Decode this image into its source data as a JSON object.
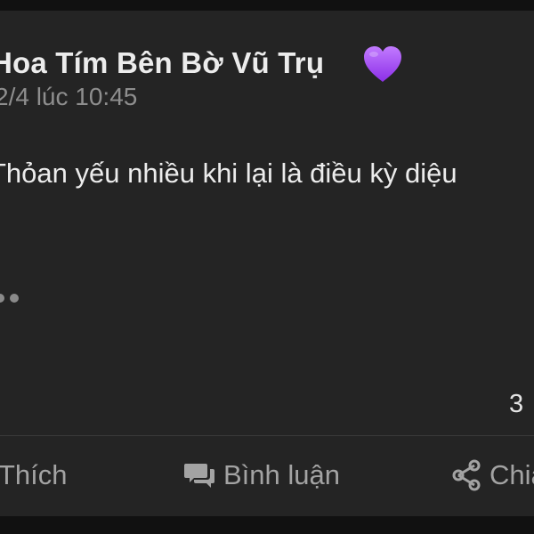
{
  "post": {
    "author": "Hoa Tím Bên Bờ Vũ Trụ",
    "author_emoji": "purple-heart",
    "timestamp": "2/4 lúc 10:45",
    "text": "Thỏan yếu nhiều khi lại là điều kỳ diệu",
    "more_indicator": "...",
    "reaction_count": "3"
  },
  "actions": {
    "like_label": "Thích",
    "comment_label": "Bình luận",
    "share_label": "Chia sẻ"
  },
  "icons": {
    "comment": "comment-icon",
    "share": "share-icon",
    "heart": "purple-heart-icon"
  },
  "colors": {
    "card_background": "#242424",
    "outer_background": "#111111",
    "primary_text": "#ececec",
    "secondary_text": "#8e8e8e",
    "action_text": "#a3a3a3",
    "heart": "#a34cff"
  }
}
